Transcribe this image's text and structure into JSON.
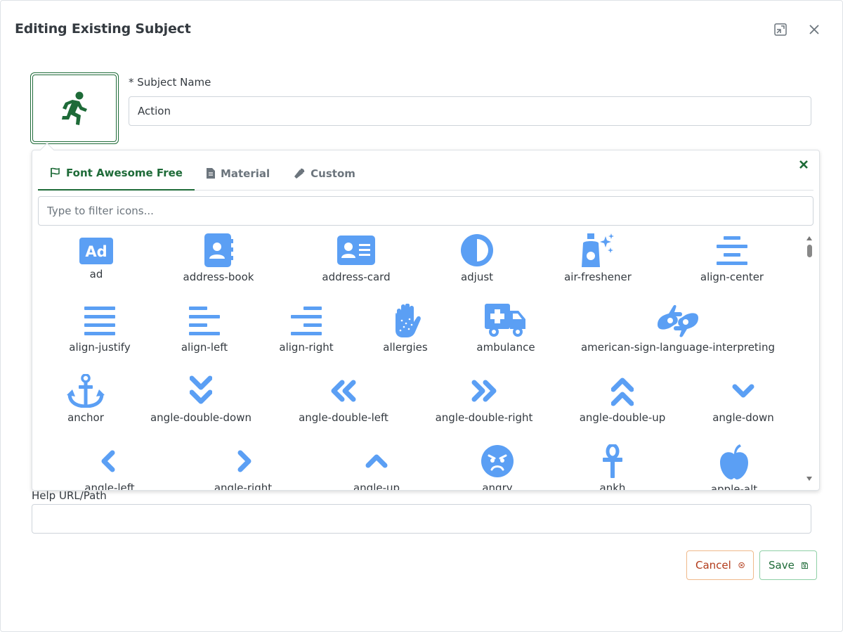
{
  "dialog": {
    "title": "Editing Existing Subject",
    "minimize_label": "minimize",
    "close_label": "close"
  },
  "subject": {
    "name_label": "* Subject Name",
    "name_value": "Action",
    "selected_icon": "running-icon"
  },
  "picker": {
    "tabs": [
      {
        "label": "Font Awesome Free",
        "icon": "flag-icon",
        "active": true
      },
      {
        "label": "Material",
        "icon": "file-icon",
        "active": false
      },
      {
        "label": "Custom",
        "icon": "wrench-icon",
        "active": false
      }
    ],
    "filter_placeholder": "Type to filter icons...",
    "icons": [
      {
        "name": "ad"
      },
      {
        "name": "address-book"
      },
      {
        "name": "address-card"
      },
      {
        "name": "adjust"
      },
      {
        "name": "air-freshener"
      },
      {
        "name": "align-center"
      },
      {
        "name": "align-justify"
      },
      {
        "name": "align-left"
      },
      {
        "name": "align-right"
      },
      {
        "name": "allergies"
      },
      {
        "name": "ambulance"
      },
      {
        "name": "american-sign-language-interpreting"
      },
      {
        "name": "anchor"
      },
      {
        "name": "angle-double-down"
      },
      {
        "name": "angle-double-left"
      },
      {
        "name": "angle-double-right"
      },
      {
        "name": "angle-double-up"
      },
      {
        "name": "angle-down"
      },
      {
        "name": "angle-left"
      },
      {
        "name": "angle-right"
      },
      {
        "name": "angle-up"
      },
      {
        "name": "angry"
      },
      {
        "name": "ankh"
      },
      {
        "name": "apple-alt"
      }
    ]
  },
  "help": {
    "label": "Help URL/Path",
    "value": ""
  },
  "actions": {
    "cancel_label": "Cancel",
    "save_label": "Save"
  },
  "colors": {
    "accent_green": "#1e6b38",
    "icon_blue": "#5b9ff4",
    "cancel_red": "#b23b1b"
  }
}
